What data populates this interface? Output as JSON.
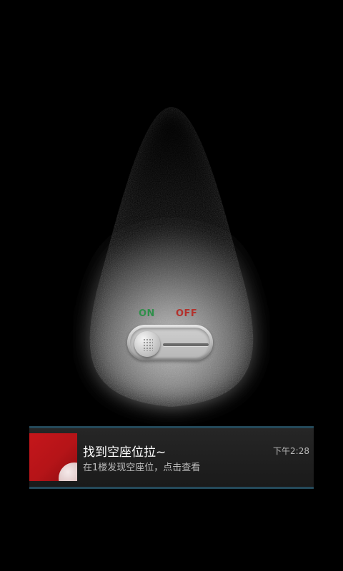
{
  "switch": {
    "on_label": "ON",
    "off_label": "OFF",
    "state": "off",
    "on_color": "#2f8f4a",
    "off_color": "#b3312c"
  },
  "notification": {
    "title": "找到空座位拉~",
    "body": "在1楼发现空座位，点击查看",
    "time": "下午2:28",
    "accent_color": "#24495a",
    "thumbnail_color": "#c5161b",
    "thumbnail_icon": "red-app-thumbnail-icon"
  }
}
